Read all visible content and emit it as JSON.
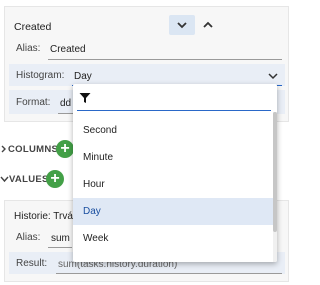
{
  "created_panel": {
    "title": "Created",
    "alias_label": "Alias:",
    "alias_value": "Created",
    "histogram_label": "Histogram:",
    "histogram_value": "Day",
    "format_label": "Format:",
    "format_value": "dd"
  },
  "sections": {
    "columns_label": "COLUMNS",
    "values_label": "VALUES"
  },
  "value_panel": {
    "title": "Historie: Trvá",
    "alias_label": "Alias:",
    "alias_value": "sum",
    "result_label": "Result:",
    "result_value": "sum(tasks.history.duration)"
  },
  "dropdown": {
    "options": [
      "Second",
      "Minute",
      "Hour",
      "Day",
      "Week"
    ],
    "selected": "Day"
  },
  "colors": {
    "accent": "#2a68c8",
    "add": "#43a047",
    "selected_bg": "#dfe8f5"
  }
}
